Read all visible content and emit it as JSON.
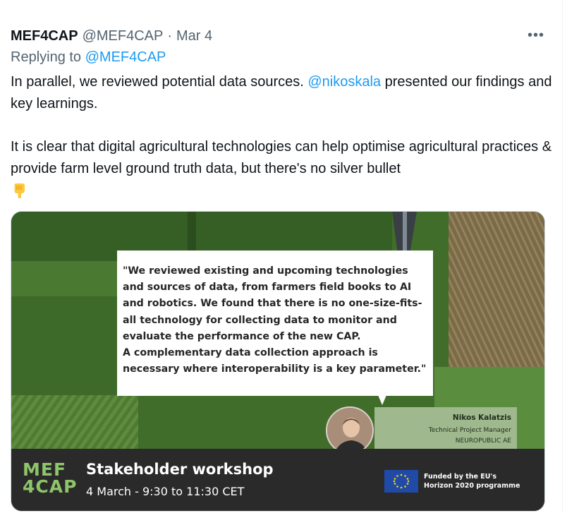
{
  "tweet": {
    "display_name": "MEF4CAP",
    "handle": "@MEF4CAP",
    "separator": "·",
    "date": "Mar 4",
    "more_label": "•••",
    "replying_prefix": "Replying to",
    "replying_to": "@MEF4CAP",
    "text_part1": "In parallel, we reviewed potential data sources.",
    "mention": "@nikoskala",
    "text_part2": "presented our findings and key learnings.",
    "text_para2": "It is clear that digital agricultural technologies can help optimise agricultural practices & provide farm level ground truth data, but there's no silver bullet",
    "emoji_icon": "backhand-index-pointing-down-icon"
  },
  "media": {
    "quote": "\"We reviewed existing and upcoming technologies\nand sources of data, from farmers field books to AI\nand robotics. We found that there is no one-size-fits-\nall technology for collecting data to monitor and\nevaluate the performance of the new CAP.\nA complementary data collection approach is\nnecessary where interoperability is a key parameter.\"",
    "speaker_name": "Nikos Kalatzis",
    "speaker_role": "Technical Project Manager",
    "speaker_org": "NEUROPUBLIC AE",
    "logo_line1": "MEF",
    "logo_line2": "4CAP",
    "workshop_title": "Stakeholder workshop",
    "workshop_date": "4 March - 9:30 to 11:30 CET",
    "eu_text": "Funded by the EU's\nHorizon 2020 programme"
  },
  "colors": {
    "link": "#1d9bf0",
    "secondary_text": "#536471",
    "logo_green": "#8ec46a",
    "eu_blue": "#1f4aa8"
  }
}
